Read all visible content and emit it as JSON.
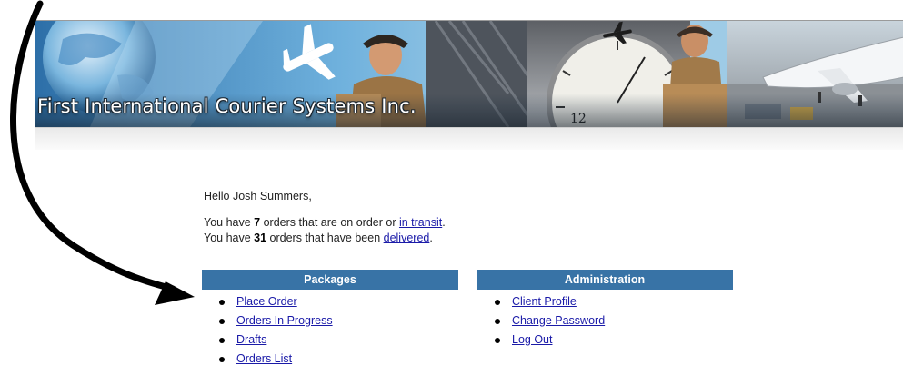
{
  "header": {
    "title": "First International Courier Systems Inc."
  },
  "greeting": {
    "hello": "Hello Josh Summers,",
    "line1_prefix": "You have ",
    "line1_count": "7",
    "line1_middle": " orders that are on order or ",
    "line1_link": "in transit",
    "line1_suffix": ".",
    "line2_prefix": "You have ",
    "line2_count": "31",
    "line2_middle": " orders that have been ",
    "line2_link": "delivered",
    "line2_suffix": "."
  },
  "packages": {
    "heading": "Packages",
    "items": [
      "Place Order",
      "Orders In Progress",
      "Drafts",
      "Orders List"
    ]
  },
  "administration": {
    "heading": "Administration",
    "items": [
      "Client Profile",
      "Change Password",
      "Log Out"
    ]
  },
  "colors": {
    "panel_header": "#3873a6",
    "link": "#1a1aa8"
  }
}
